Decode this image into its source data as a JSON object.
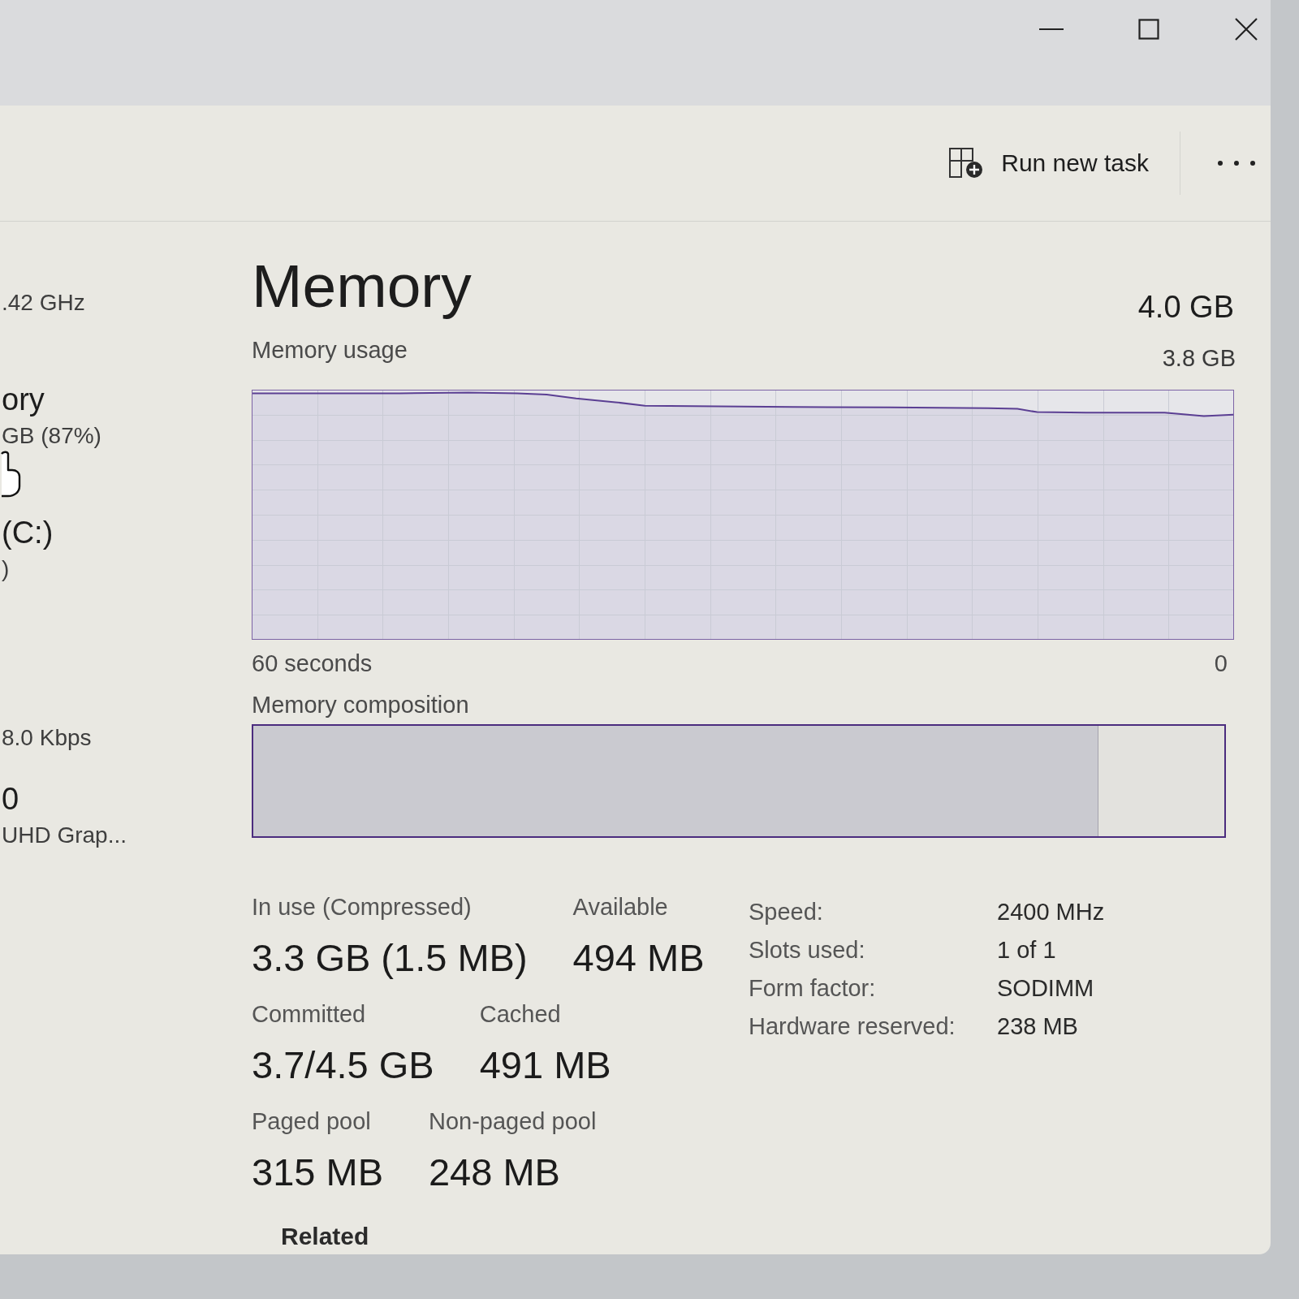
{
  "window": {
    "controls": [
      {
        "kind": "minimize"
      },
      {
        "kind": "maximize"
      },
      {
        "kind": "close"
      }
    ]
  },
  "toolbar": {
    "actions": [
      {
        "kind": "run",
        "label": "Run new task"
      },
      {
        "kind": "more"
      }
    ]
  },
  "sidebar": {
    "items": [
      {
        "subtitle": ".42 GHz"
      },
      {
        "title": "ory",
        "subtitle": "GB (87%)"
      },
      {
        "title": "(C:)",
        "subtitle": ")"
      },
      {
        "status": "8.0 Kbps"
      },
      {
        "title": "0",
        "subtitle": "UHD Grap..."
      }
    ]
  },
  "performance": {
    "title": "Memory",
    "capacity": "4.0 GB",
    "usage": {
      "title": "Memory usage",
      "max_label": "3.8 GB",
      "start_label": "60 seconds",
      "end_label": "0"
    },
    "composition": {
      "title": "Memory composition",
      "level": 0.87
    },
    "stats": [
      [
        {
          "label": "In use (Compressed)",
          "value": "3.3 GB (1.5 MB)"
        },
        {
          "label": "Available",
          "value": "494 MB"
        }
      ],
      [
        {
          "label": "Committed",
          "value": "3.7/4.5 GB"
        },
        {
          "label": "Cached",
          "value": "491 MB"
        }
      ],
      [
        {
          "label": "Paged pool",
          "value": "315 MB"
        },
        {
          "label": "Non-paged pool",
          "value": "248 MB"
        }
      ]
    ],
    "specs": [
      {
        "label": "Speed:",
        "value": "2400 MHz"
      },
      {
        "label": "Slots used:",
        "value": "1 of 1"
      },
      {
        "label": "Form factor:",
        "value": "SODIMM"
      },
      {
        "label": "Hardware reserved:",
        "value": "238 MB"
      }
    ],
    "related": "Related"
  }
}
